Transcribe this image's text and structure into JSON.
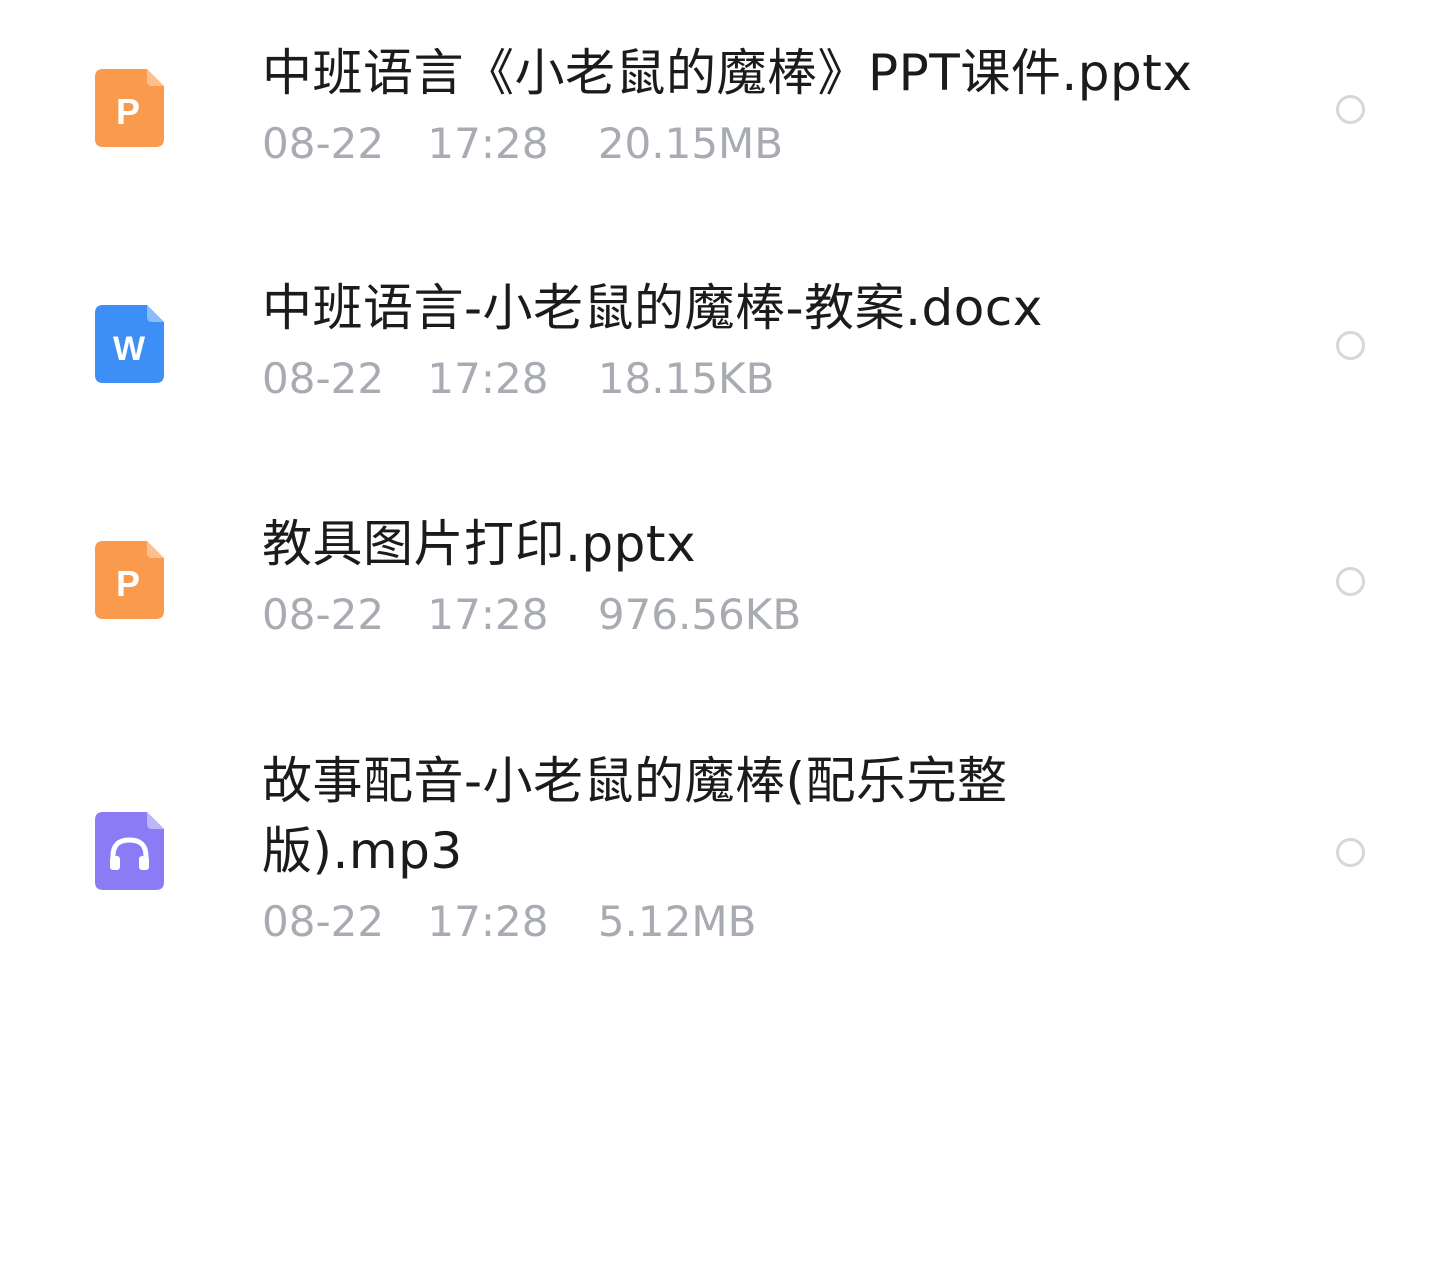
{
  "files": [
    {
      "name": "中班语言《小老鼠的魔棒》PPT课件.pptx",
      "date": "08-22",
      "time": "17:28",
      "size": "20.15MB",
      "icon": "pptx-file-icon",
      "icon_letter": "P",
      "icon_color": "#fa9a4c"
    },
    {
      "name": "中班语言-小老鼠的魔棒-教案.docx",
      "date": "08-22",
      "time": "17:28",
      "size": "18.15KB",
      "icon": "docx-file-icon",
      "icon_letter": "W",
      "icon_color": "#3d8ef5"
    },
    {
      "name": "教具图片打印.pptx",
      "date": "08-22",
      "time": "17:28",
      "size": "976.56KB",
      "icon": "pptx-file-icon",
      "icon_letter": "P",
      "icon_color": "#fa9a4c"
    },
    {
      "name": "故事配音-小老鼠的魔棒(配乐完整版).mp3",
      "date": "08-22",
      "time": "17:28",
      "size": "5.12MB",
      "icon": "audio-file-icon",
      "icon_letter": "",
      "icon_color": "#8b7cf6"
    }
  ],
  "colors": {
    "text_primary": "#1b1b1b",
    "text_secondary": "#a8acb2",
    "radio_border": "#d5d7da"
  }
}
